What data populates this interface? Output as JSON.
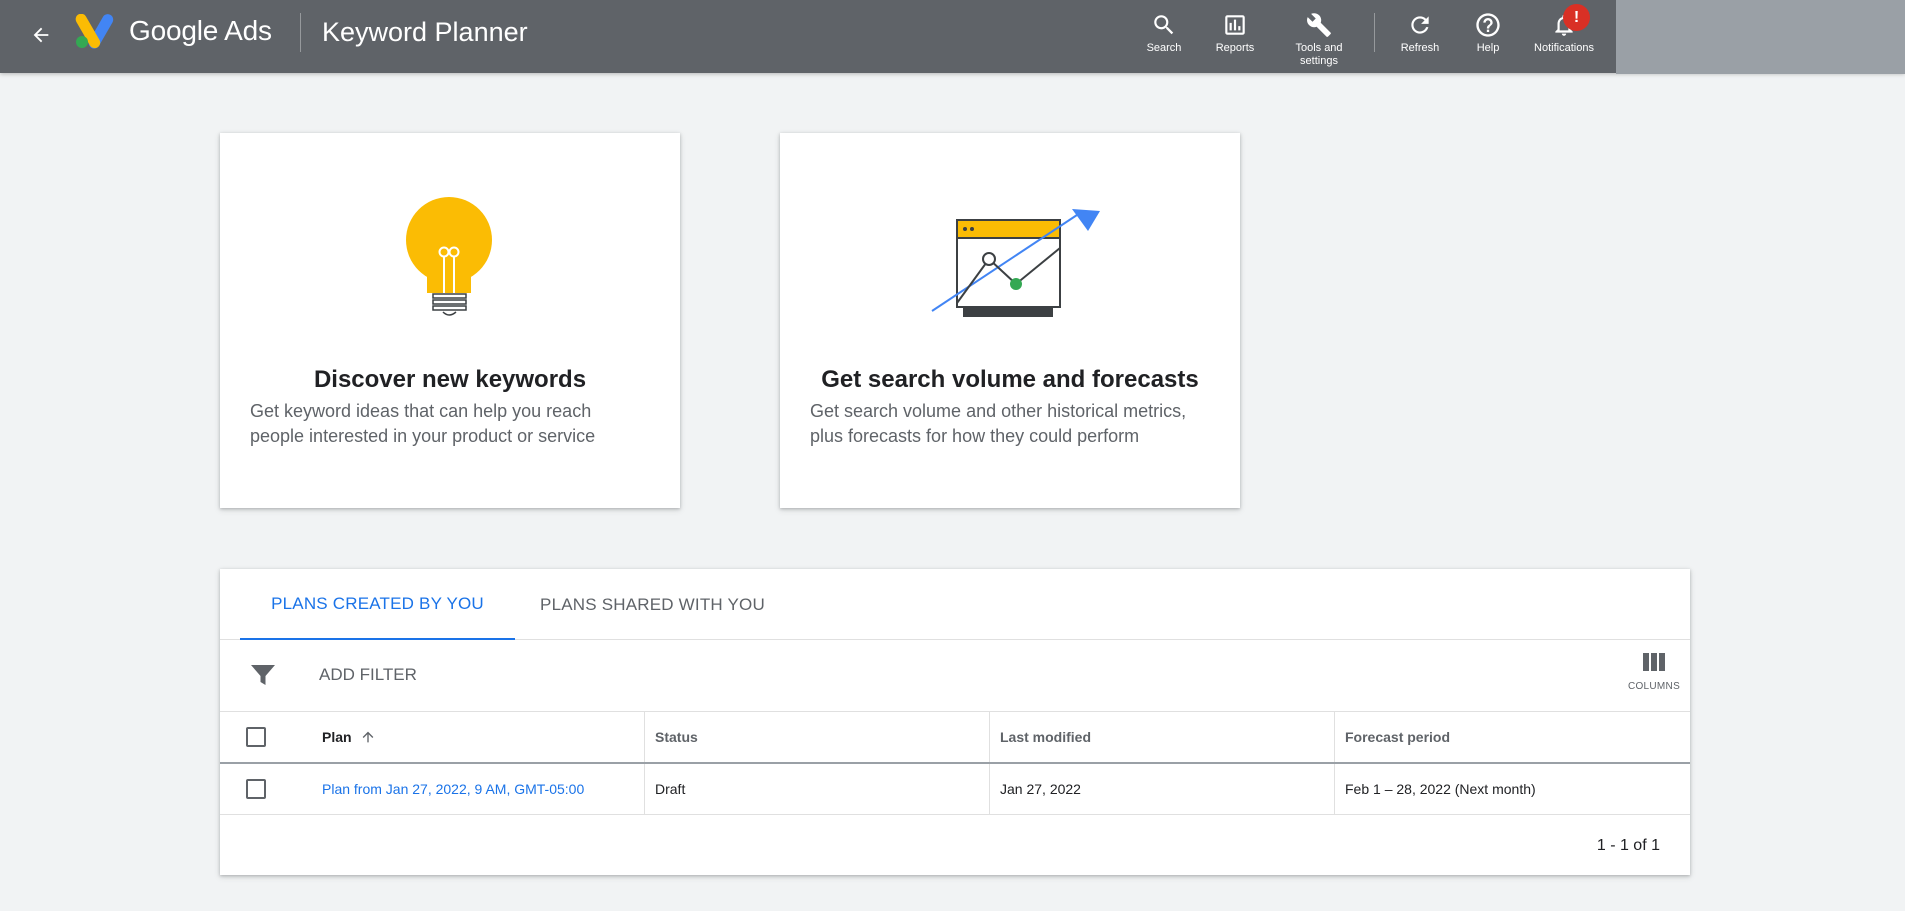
{
  "header": {
    "brand": "Google Ads",
    "tool_title": "Keyword Planner",
    "buttons": [
      {
        "label": "Search",
        "icon": "search-icon"
      },
      {
        "label": "Reports",
        "icon": "reports-icon"
      },
      {
        "label": "Tools and settings",
        "icon": "wrench-icon"
      },
      {
        "label": "Refresh",
        "icon": "refresh-icon"
      },
      {
        "label": "Help",
        "icon": "help-icon"
      },
      {
        "label": "Notifications",
        "icon": "bell-icon"
      }
    ],
    "notification_badge": "!"
  },
  "cards": [
    {
      "title": "Discover new keywords",
      "description": "Get keyword ideas that can help you reach people interested in your product or service",
      "icon": "lightbulb-icon"
    },
    {
      "title": "Get search volume and forecasts",
      "description": "Get search volume and other historical metrics, plus forecasts for how they could perform",
      "icon": "forecast-chart-icon"
    }
  ],
  "plans": {
    "tabs": [
      "PLANS CREATED BY YOU",
      "PLANS SHARED WITH YOU"
    ],
    "active_tab": 0,
    "add_filter_label": "ADD FILTER",
    "columns_label": "COLUMNS",
    "table": {
      "headers": [
        "Plan",
        "Status",
        "Last modified",
        "Forecast period"
      ],
      "rows": [
        {
          "plan": "Plan from Jan 27, 2022, 9 AM, GMT-05:00",
          "status": "Draft",
          "last_modified": "Jan 27, 2022",
          "forecast_period": "Feb 1 – 28, 2022 (Next month)"
        }
      ]
    },
    "pagination": "1 - 1 of 1"
  },
  "colors": {
    "header_bg": "#5f6368",
    "accent": "#1a73e8",
    "bulb": "#fbbc04",
    "forecast_arrow": "#4285f4",
    "forecast_dot": "#34a853",
    "badge": "#d93025"
  }
}
